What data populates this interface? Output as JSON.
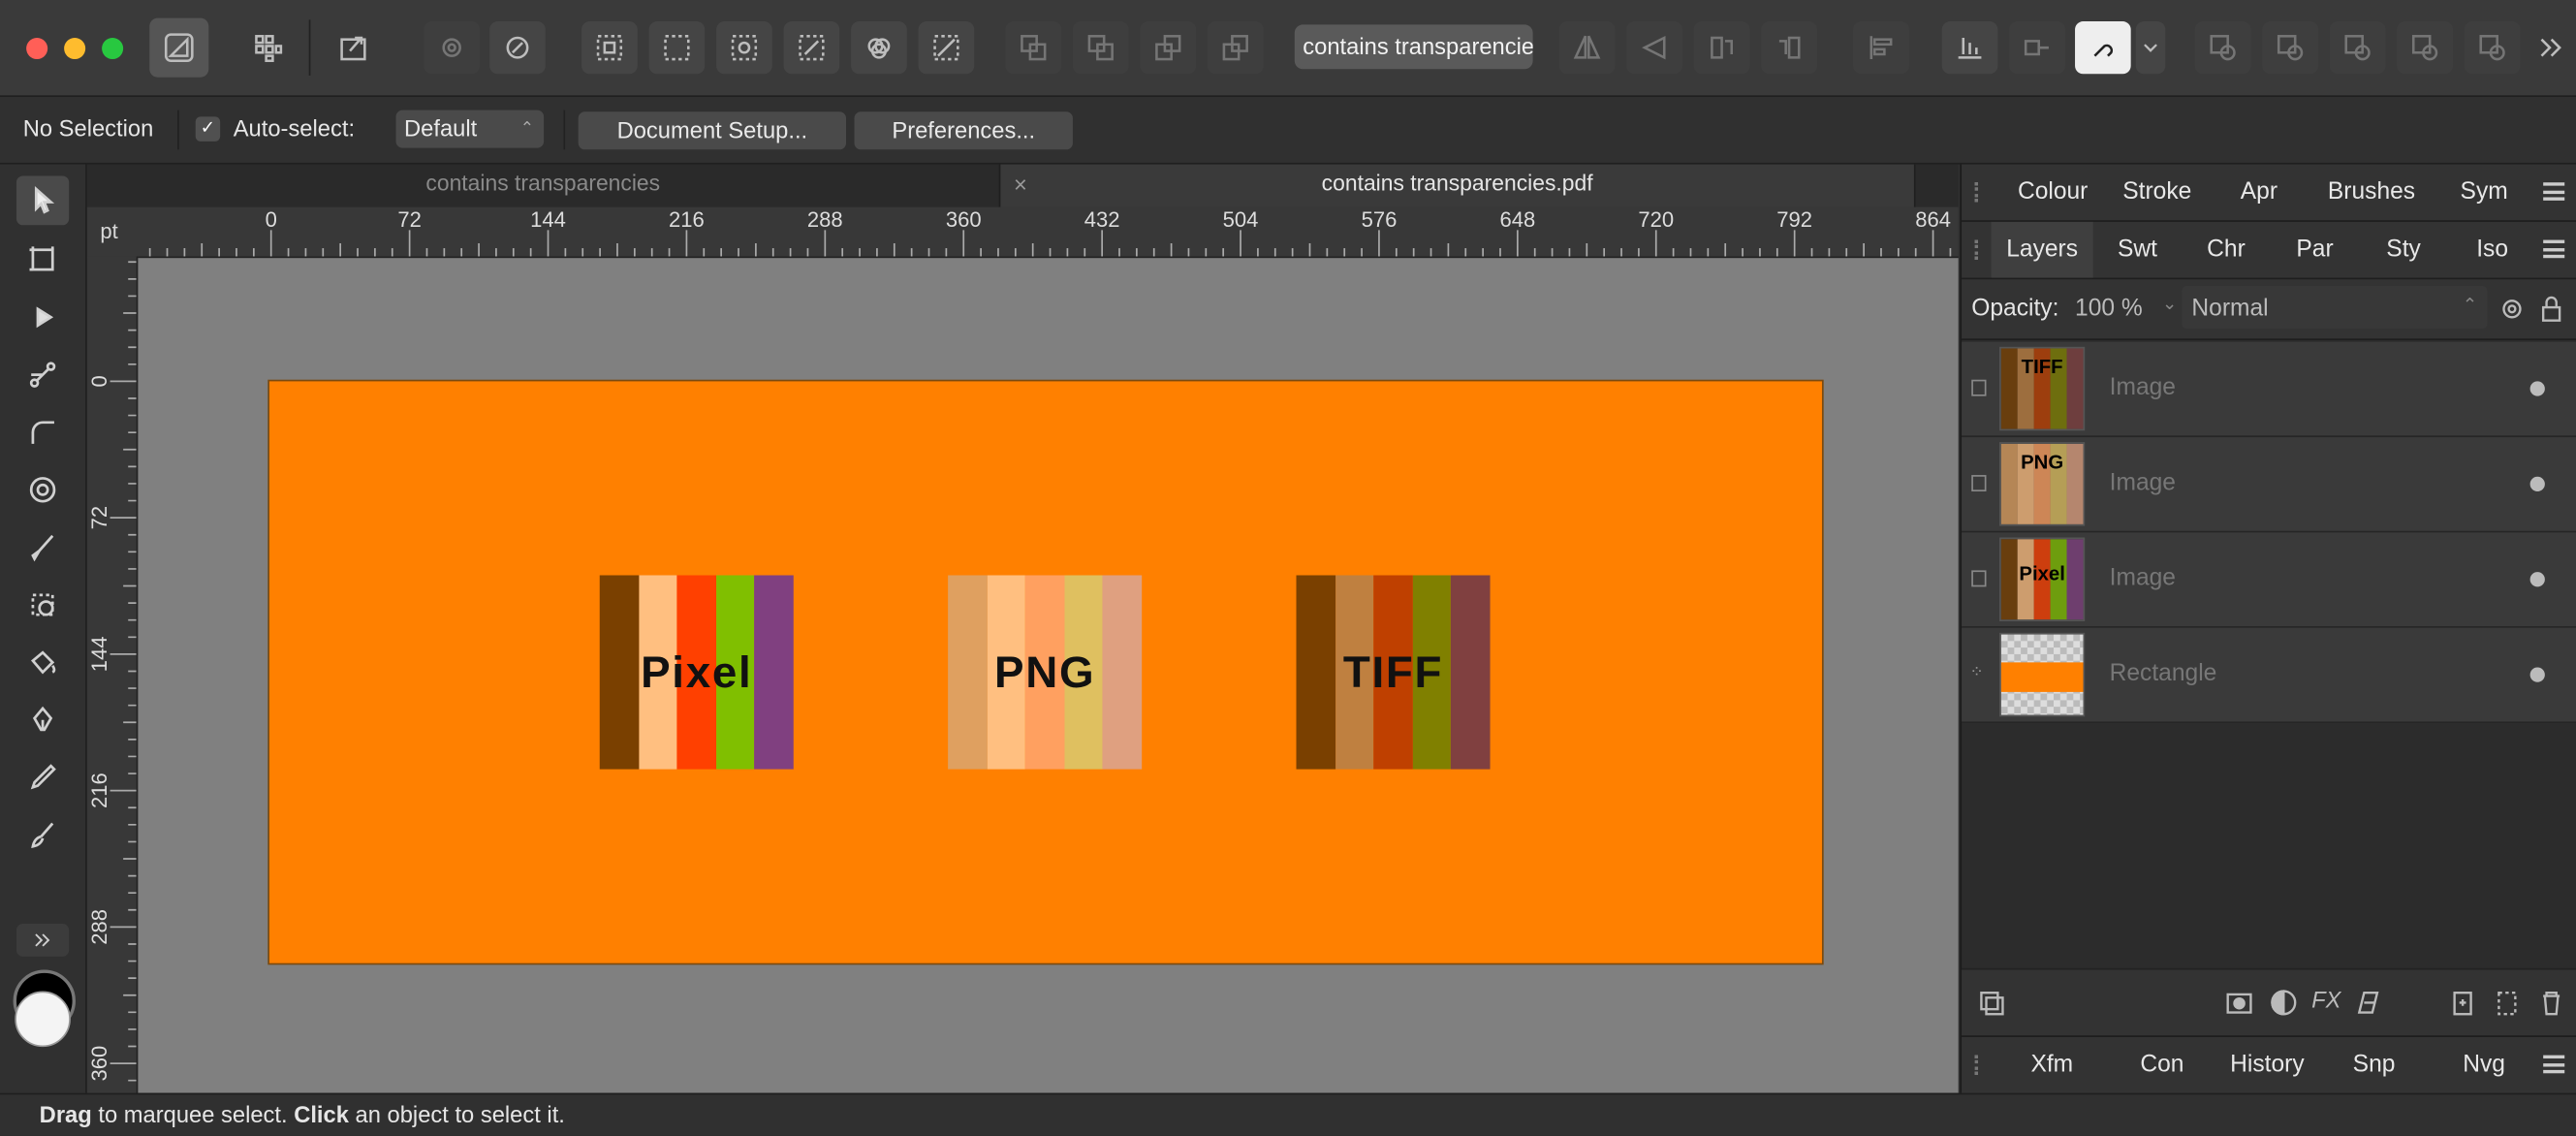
{
  "toolbar": {
    "search_value": "contains transparencies",
    "traffic_colors": [
      "#ff5f57",
      "#febc2e",
      "#28c840"
    ]
  },
  "context_bar": {
    "selection": "No Selection",
    "autoselect_label": "Auto-select:",
    "autoselect_checked": true,
    "autoselect_mode": "Default",
    "doc_setup": "Document Setup...",
    "preferences": "Preferences..."
  },
  "tabs": [
    {
      "label": "contains transparencies",
      "active": false
    },
    {
      "label": "contains transparencies.pdf",
      "active": true
    }
  ],
  "ruler": {
    "unit": "pt",
    "h_ticks": [
      "0",
      "72",
      "144",
      "216",
      "288",
      "360",
      "432",
      "504",
      "576",
      "648",
      "720",
      "792",
      "864"
    ],
    "v_ticks": [
      "0",
      "72",
      "144",
      "216",
      "288",
      "360"
    ]
  },
  "document": {
    "background": "#ff8000",
    "images": [
      {
        "label": "Pixel",
        "stripes": [
          "#7a4000",
          "#ffbf80",
          "#ff4000",
          "#80bf00",
          "#804080"
        ]
      },
      {
        "label": "PNG",
        "stripes": [
          "#dfa060",
          "#ffbf80",
          "#ffa060",
          "#dfc060",
          "#dfa080"
        ]
      },
      {
        "label": "TIFF",
        "stripes": [
          "#7a4000",
          "#bf8040",
          "#bf4000",
          "#808000",
          "#804040"
        ]
      }
    ]
  },
  "panels": {
    "top_tabs": [
      "Colour",
      "Stroke",
      "Apr",
      "Brushes",
      "Sym"
    ],
    "layer_tabs": [
      "Layers",
      "Swt",
      "Chr",
      "Par",
      "Sty",
      "Iso"
    ],
    "active_layer_tab": "Layers",
    "opacity_label": "Opacity:",
    "opacity_value": "100 %",
    "blend_mode": "Normal",
    "layers": [
      {
        "thumb": "TIFF",
        "name": "Image"
      },
      {
        "thumb": "PNG",
        "name": "Image"
      },
      {
        "thumb": "Pixel",
        "name": "Image"
      },
      {
        "thumb": "",
        "name": "Rectangle"
      }
    ],
    "bottom_tabs": [
      "Xfm",
      "Con",
      "History",
      "Snp",
      "Nvg"
    ]
  },
  "status": {
    "drag_word": "Drag",
    "drag_text": " to marquee select. ",
    "click_word": "Click",
    "click_text": " an object to select it."
  }
}
